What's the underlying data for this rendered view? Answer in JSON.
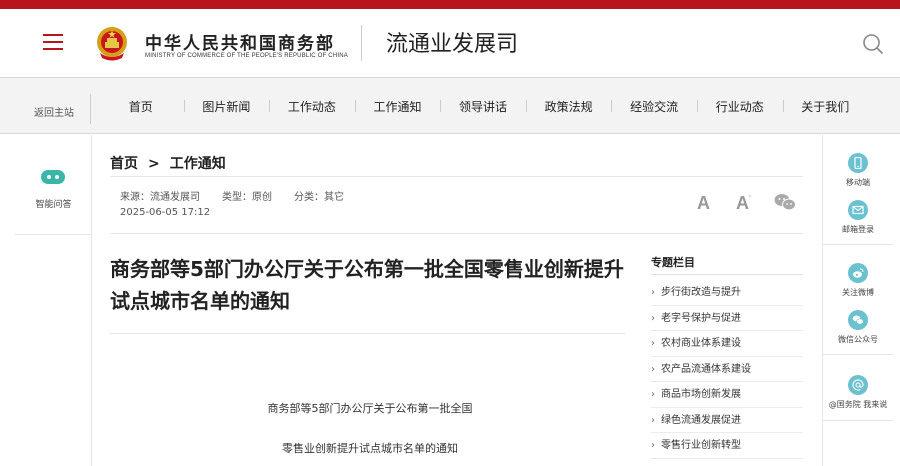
{
  "header": {
    "brand_cn": "中华人民共和国商务部",
    "brand_en": "MINISTRY OF COMMERCE OF THE PEOPLE'S REPUBLIC OF CHINA",
    "department": "流通业发展司"
  },
  "nav": {
    "back_home": "返回主站",
    "items": [
      "首页",
      "图片新闻",
      "工作动态",
      "工作通知",
      "领导讲话",
      "政策法规",
      "经验交流",
      "行业动态",
      "关于我们"
    ]
  },
  "left_sidebar": {
    "qa_label": "智能问答"
  },
  "breadcrumb": {
    "home": "首页",
    "separator": ">",
    "current": "工作通知"
  },
  "article": {
    "source": "来源：流通发展司",
    "type": "类型：原创",
    "category": "分类：其它",
    "date": "2025-06-05 17:12",
    "font_large": "A",
    "font_small": "A",
    "font_small_mark": "-",
    "title": "商务部等5部门办公厅关于公布第一批全国零售业创新提升试点城市名单的通知",
    "body_line1": "商务部等5部门办公厅关于公布第一批全国",
    "body_line2": "零售业创新提升试点城市名单的通知"
  },
  "topics": {
    "title": "专题栏目",
    "items": [
      "步行街改造与提升",
      "老字号保护与促进",
      "农村商业体系建设",
      "农产品流通体系建设",
      "商品市场创新发展",
      "绿色流通发展促进",
      "零售行业创新转型"
    ]
  },
  "right_sidebar": {
    "items": [
      "移动端",
      "邮箱登录",
      "关注微博",
      "微信公众号",
      "@国务院 我来说"
    ]
  },
  "colors": {
    "brand_red": "#b8141b",
    "sidebar_icon": "#6cc1d1",
    "bot_icon": "#3bb5a6"
  }
}
